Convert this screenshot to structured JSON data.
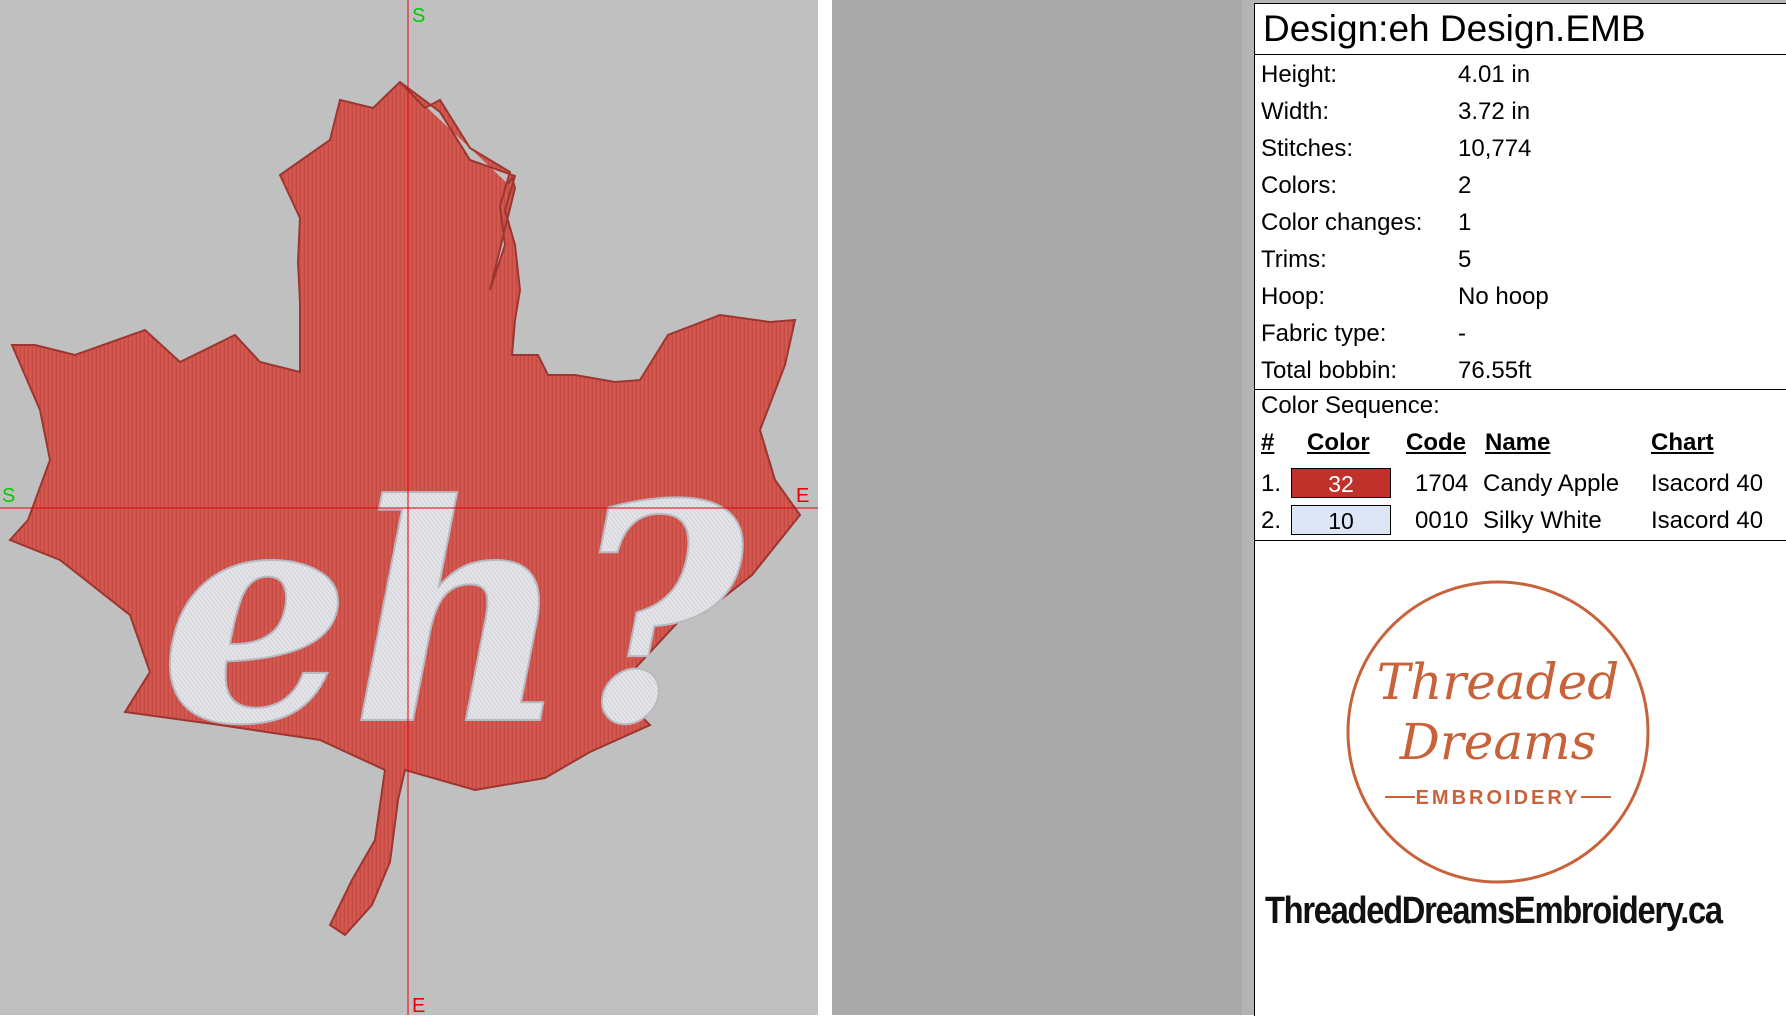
{
  "canvas": {
    "axis_labels": {
      "top": "S",
      "bottom": "E",
      "left": "S",
      "right": "E"
    },
    "embroidery_text": "eh?",
    "colors": {
      "leaf": "#d1524a",
      "text": "#e4e4ea",
      "crosshair": "#e8000a",
      "axis_top_left": "#00cc00",
      "axis_bottom_right": "#e8000a"
    }
  },
  "info": {
    "title": "Design:eh Design.EMB",
    "rows": [
      {
        "label": "Height:",
        "value": "4.01 in"
      },
      {
        "label": "Width:",
        "value": "3.72 in"
      },
      {
        "label": "Stitches:",
        "value": "10,774"
      },
      {
        "label": "Colors:",
        "value": "2"
      },
      {
        "label": "Color changes:",
        "value": "1"
      },
      {
        "label": "Trims:",
        "value": "5"
      },
      {
        "label": "Hoop:",
        "value": "No hoop"
      },
      {
        "label": "Fabric type:",
        "value": "-"
      },
      {
        "label": "Total bobbin:",
        "value": "76.55ft"
      }
    ],
    "sequence_label": "Color Sequence:",
    "headers": {
      "num": "#",
      "color": "Color",
      "code": "Code",
      "name": "Name",
      "chart": "Chart"
    },
    "sequence": [
      {
        "num": "1.",
        "swatch": "32",
        "swatch_bg": "#c0312b",
        "swatch_fg": "#ffffff",
        "code": "1704",
        "name": "Candy Apple",
        "chart": "Isacord 40"
      },
      {
        "num": "2.",
        "swatch": "10",
        "swatch_bg": "#dde6f6",
        "swatch_fg": "#000000",
        "code": "0010",
        "name": "Silky White",
        "chart": "Isacord 40"
      }
    ]
  },
  "logo": {
    "line1": "Threaded",
    "line2": "Dreams",
    "line3": "EMBROIDERY",
    "color": "#c8623a"
  },
  "website": "ThreadedDreamsEmbroidery.ca"
}
